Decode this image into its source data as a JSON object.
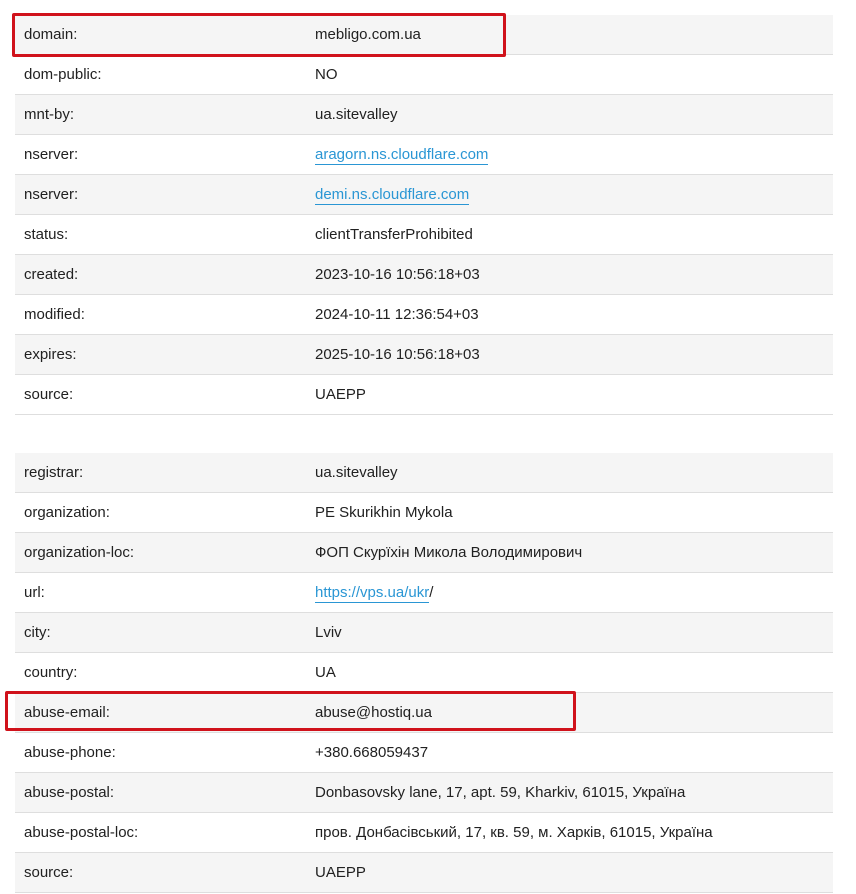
{
  "domain_block": [
    {
      "key": "domain:",
      "value": "mebligo.com.ua"
    },
    {
      "key": "dom-public:",
      "value": "NO"
    },
    {
      "key": "mnt-by:",
      "value": "ua.sitevalley"
    },
    {
      "key": "nserver:",
      "value": "aragorn.ns.cloudflare.com",
      "link": true
    },
    {
      "key": "nserver:",
      "value": "demi.ns.cloudflare.com",
      "link": true
    },
    {
      "key": "status:",
      "value": "clientTransferProhibited"
    },
    {
      "key": "created:",
      "value": "2023-10-16 10:56:18+03"
    },
    {
      "key": "modified:",
      "value": "2024-10-11 12:36:54+03"
    },
    {
      "key": "expires:",
      "value": "2025-10-16 10:56:18+03"
    },
    {
      "key": "source:",
      "value": "UAEPP"
    }
  ],
  "registrar_block": [
    {
      "key": "registrar:",
      "value": "ua.sitevalley"
    },
    {
      "key": "organization:",
      "value": "PE Skurikhin Mykola"
    },
    {
      "key": "organization-loc:",
      "value": "ФОП Скурїхін Микола Володимирович"
    },
    {
      "key": "url:",
      "value": "https://vps.ua/ukr",
      "link": true,
      "suffix": "/"
    },
    {
      "key": "city:",
      "value": "Lviv"
    },
    {
      "key": "country:",
      "value": "UA"
    },
    {
      "key": "abuse-email:",
      "value": "abuse@hostiq.ua"
    },
    {
      "key": "abuse-phone:",
      "value": "+380.668059437"
    },
    {
      "key": "abuse-postal:",
      "value": "Donbasovsky lane, 17, apt. 59, Kharkiv, 61015, Україна"
    },
    {
      "key": "abuse-postal-loc:",
      "value": "пров. Донбасівський, 17, кв. 59, м. Харків, 61015, Україна"
    },
    {
      "key": "source:",
      "value": "UAEPP"
    }
  ],
  "colors": {
    "highlight": "#d0121b",
    "link": "#2a96d4",
    "row_alt": "#f5f5f5"
  }
}
